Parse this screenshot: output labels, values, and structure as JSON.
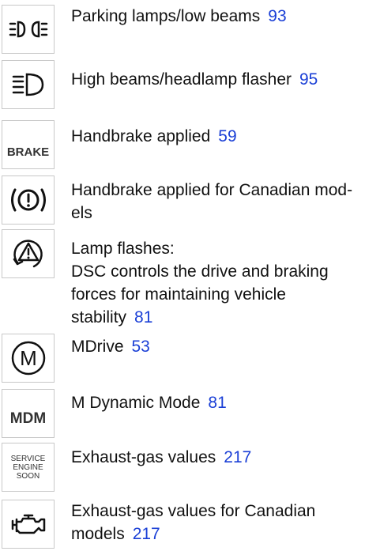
{
  "entries": [
    {
      "icon": "parking-lamps-icon",
      "text": "Parking lamps/low beams",
      "page": "93"
    },
    {
      "icon": "high-beams-icon",
      "text": "High beams/headlamp flasher",
      "page": "95"
    },
    {
      "icon": "brake-text-icon",
      "icon_text": "BRAKE",
      "text": "Handbrake applied",
      "page": "59"
    },
    {
      "icon": "brake-warning-icon",
      "text": "Handbrake applied for Canadian mod-\nels",
      "line1": "Handbrake applied for Canadian mod-",
      "line2": "els"
    },
    {
      "icon": "dsc-icon",
      "line1": "Lamp flashes:",
      "line2": "DSC controls the drive and braking",
      "line3": "forces for maintaining vehicle",
      "line4": "stability",
      "page": "81"
    },
    {
      "icon": "mdrive-icon",
      "icon_text": "M",
      "text": "MDrive",
      "page": "53"
    },
    {
      "icon": "mdm-icon",
      "icon_text": "MDM",
      "text": "M Dynamic Mode",
      "page": "81"
    },
    {
      "icon": "service-engine-soon-icon",
      "icon_line1": "SERVICE",
      "icon_line2": "ENGINE",
      "icon_line3": "SOON",
      "text": "Exhaust-gas values",
      "page": "217"
    },
    {
      "icon": "check-engine-icon",
      "line1": "Exhaust-gas values for Canadian",
      "line2": "models",
      "page": "217"
    }
  ],
  "colors": {
    "link": "#1a3fd6",
    "text": "#111111",
    "border": "#c8c8c8"
  }
}
